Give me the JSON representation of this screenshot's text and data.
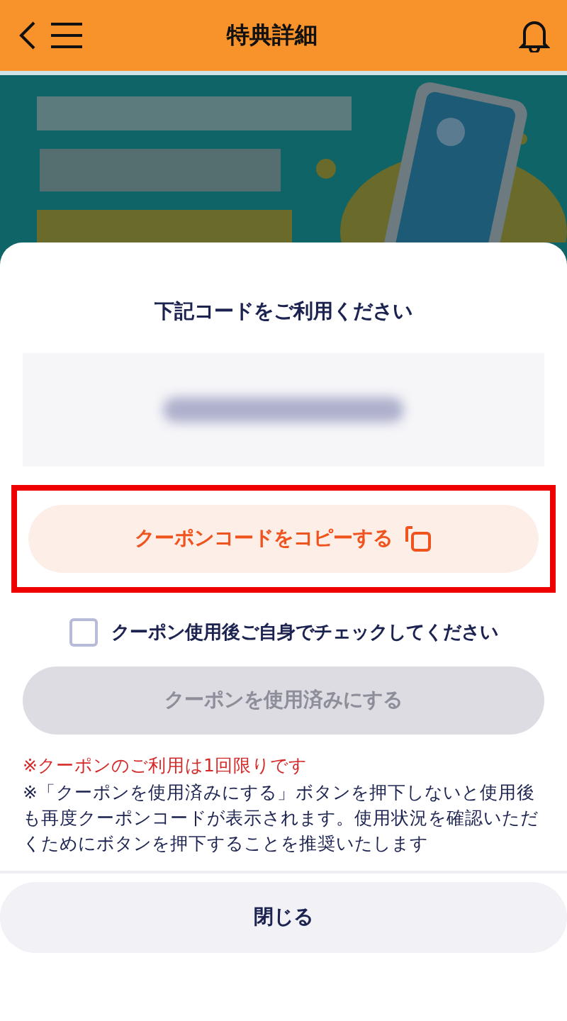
{
  "header": {
    "title": "特典詳細"
  },
  "sheet": {
    "heading": "下記コードをご利用ください",
    "code": {
      "blurred": true
    },
    "copy_button": {
      "label": "クーポンコードをコピーする",
      "highlighted": true
    },
    "check": {
      "label": "クーポン使用後ご自身でチェックしてください",
      "checked": false
    },
    "use_button": {
      "label": "クーポンを使用済みにする",
      "disabled": true
    },
    "notes": [
      {
        "kind": "warning",
        "text": "※クーポンのご利用は1回限りです"
      },
      {
        "kind": "info",
        "text": "※「クーポンを使用済みにする」ボタンを押下しないと使用後も再度クーポンコードが表示されます。使用状況を確認いただくためにボタンを押下することを推奨いたします"
      }
    ],
    "close_button": {
      "label": "閉じる"
    }
  }
}
